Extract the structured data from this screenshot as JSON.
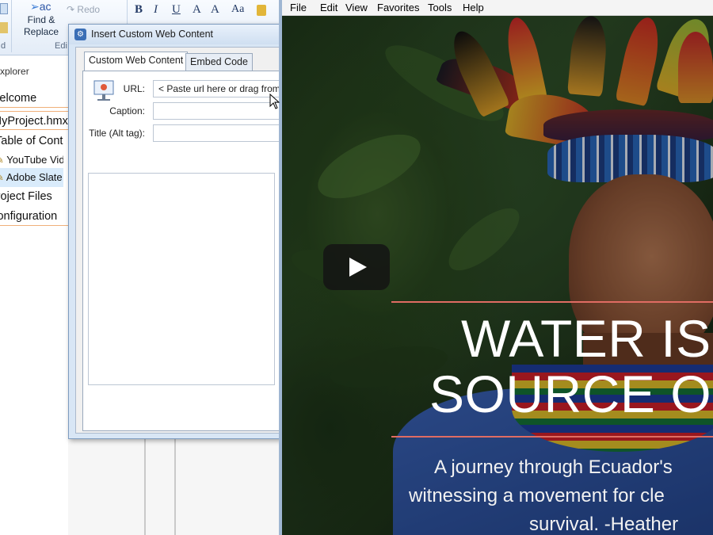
{
  "ribbon": {
    "find_replace_line1": "Find &",
    "find_replace_line2": "Replace",
    "redo_label": "Redo",
    "ac_label": "ac",
    "group_edit_label": "Edi",
    "group_d_label": "d",
    "format_buttons": [
      "B",
      "I",
      "U",
      "A",
      "A",
      "Aa"
    ]
  },
  "explorer": {
    "header": "Explorer",
    "items": [
      {
        "label": "Welcome"
      },
      {
        "label": "MyProject.hmxz"
      },
      {
        "label": "Table of Contents"
      },
      {
        "label": "YouTube Video"
      },
      {
        "label": "Adobe Slate"
      },
      {
        "label": "Project Files"
      },
      {
        "label": "Configuration"
      }
    ]
  },
  "dialog": {
    "title": "Insert Custom Web Content",
    "tabs": [
      {
        "label": "Custom Web Content",
        "active": true
      },
      {
        "label": "Embed Code",
        "active": false
      }
    ],
    "url_label": "URL:",
    "url_placeholder": "< Paste url here or drag from",
    "caption_label": "Caption:",
    "caption_value": "",
    "title_label": "Title (Alt tag):",
    "title_value": ""
  },
  "browser": {
    "menu": [
      "File",
      "Edit",
      "View",
      "Favorites",
      "Tools",
      "Help"
    ]
  },
  "video": {
    "headline_line1": "WATER IS",
    "headline_line2": "SOURCE O",
    "subline_line1": "A journey through Ecuador's",
    "subline_line2": "witnessing a movement for cle",
    "subline_line3": "survival. -Heather",
    "accent_color": "#e06c63"
  }
}
